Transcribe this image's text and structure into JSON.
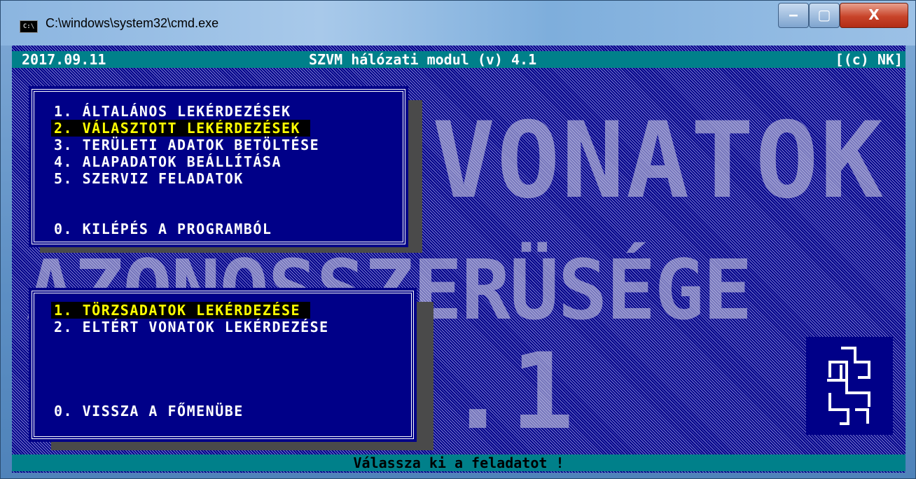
{
  "window": {
    "title": "C:\\windows\\system32\\cmd.exe",
    "icon_text": "C:\\",
    "buttons": {
      "minimize": "‒",
      "maximize": "▢",
      "close": "X"
    }
  },
  "header": {
    "date": "2017.09.11",
    "title": "SZVM hálózati modul (v) 4.1",
    "copyright": "[(c) NK]"
  },
  "background_text": {
    "line1": "VONATOK",
    "line2": "AZONOSSZERÜSÉGE",
    "line3": ".1"
  },
  "main_menu": {
    "items": [
      {
        "label": "1. ÁLTALÁNOS LEKÉRDEZÉSEK",
        "selected": false
      },
      {
        "label": "2. VÁLASZTOTT LEKÉRDEZÉSEK",
        "selected": true
      },
      {
        "label": "3. TERÜLETI ADATOK BETÖLTÉSE",
        "selected": false
      },
      {
        "label": "4. ALAPADATOK BEÁLLÍTÁSA",
        "selected": false
      },
      {
        "label": "5. SZERVIZ FELADATOK",
        "selected": false
      }
    ],
    "exit": "0. KILÉPÉS A PROGRAMBÓL"
  },
  "sub_menu": {
    "items": [
      {
        "label": "1. TÖRZSADATOK LEKÉRDEZÉSE",
        "selected": true
      },
      {
        "label": "2. ELTÉRT VONATOK LEKÉRDEZÉSE",
        "selected": false
      }
    ],
    "back": "0. VISSZA A FŐMENÜBE"
  },
  "status": {
    "prompt": "Válassza ki a feladatot !"
  },
  "colors": {
    "console_bg": "#000088",
    "bar_bg": "#00808a",
    "selected_fg": "#ffff00",
    "text": "#ffffff"
  }
}
